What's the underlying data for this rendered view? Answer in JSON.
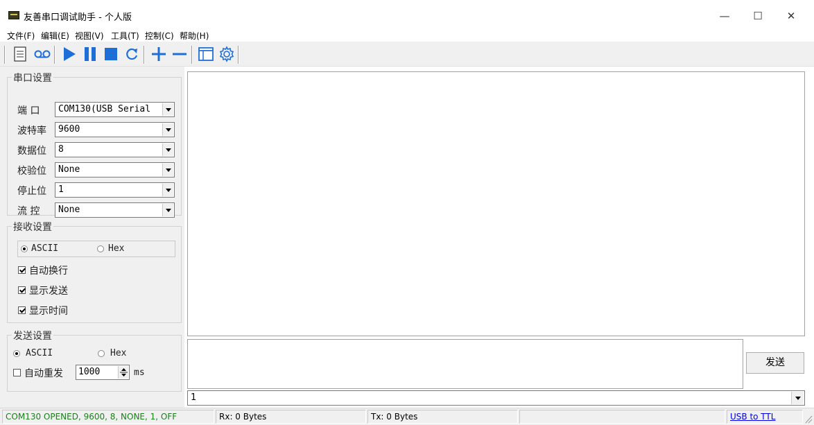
{
  "window": {
    "title": "友善串口调试助手 - 个人版",
    "minimize": "—",
    "maximize": "☐",
    "close": "✕"
  },
  "menu": [
    "文件(F)",
    "编辑(E)",
    "视图(V)",
    "工具(T)",
    "控制(C)",
    "帮助(H)"
  ],
  "toolbar": {
    "icons": [
      "document-icon",
      "record-icon",
      "play-icon",
      "pause-icon",
      "stop-icon",
      "refresh-icon",
      "add-icon",
      "remove-icon",
      "window-icon",
      "settings-icon"
    ]
  },
  "serial_settings": {
    "title": "串口设置",
    "port": {
      "label": "端  口",
      "value": "COM130(USB Serial"
    },
    "baud": {
      "label": "波特率",
      "value": "9600"
    },
    "databits": {
      "label": "数据位",
      "value": "8"
    },
    "parity": {
      "label": "校验位",
      "value": "None"
    },
    "stopbits": {
      "label": "停止位",
      "value": "1"
    },
    "flow": {
      "label": "流  控",
      "value": "None"
    }
  },
  "receive_settings": {
    "title": "接收设置",
    "ascii_label": "ASCII",
    "hex_label": "Hex",
    "ascii_selected": true,
    "auto_newline": {
      "label": "自动换行",
      "checked": true
    },
    "show_send": {
      "label": "显示发送",
      "checked": true
    },
    "show_time": {
      "label": "显示时间",
      "checked": true
    }
  },
  "send_settings": {
    "title": "发送设置",
    "ascii_label": "ASCII",
    "hex_label": "Hex",
    "ascii_selected": true,
    "auto_resend": {
      "label": "自动重发",
      "checked": false
    },
    "interval": "1000",
    "unit": "ms"
  },
  "send_button": "发送",
  "send_history": "1",
  "status": {
    "port_status": "COM130 OPENED, 9600, 8, NONE, 1, OFF",
    "rx": "Rx: 0 Bytes",
    "tx": "Tx: 0 Bytes",
    "link": "USB to TTL"
  },
  "colors": {
    "status_ok": "#1a7f1a",
    "link": "#0000ee",
    "toolbar_icon": "#1e6ed8"
  }
}
